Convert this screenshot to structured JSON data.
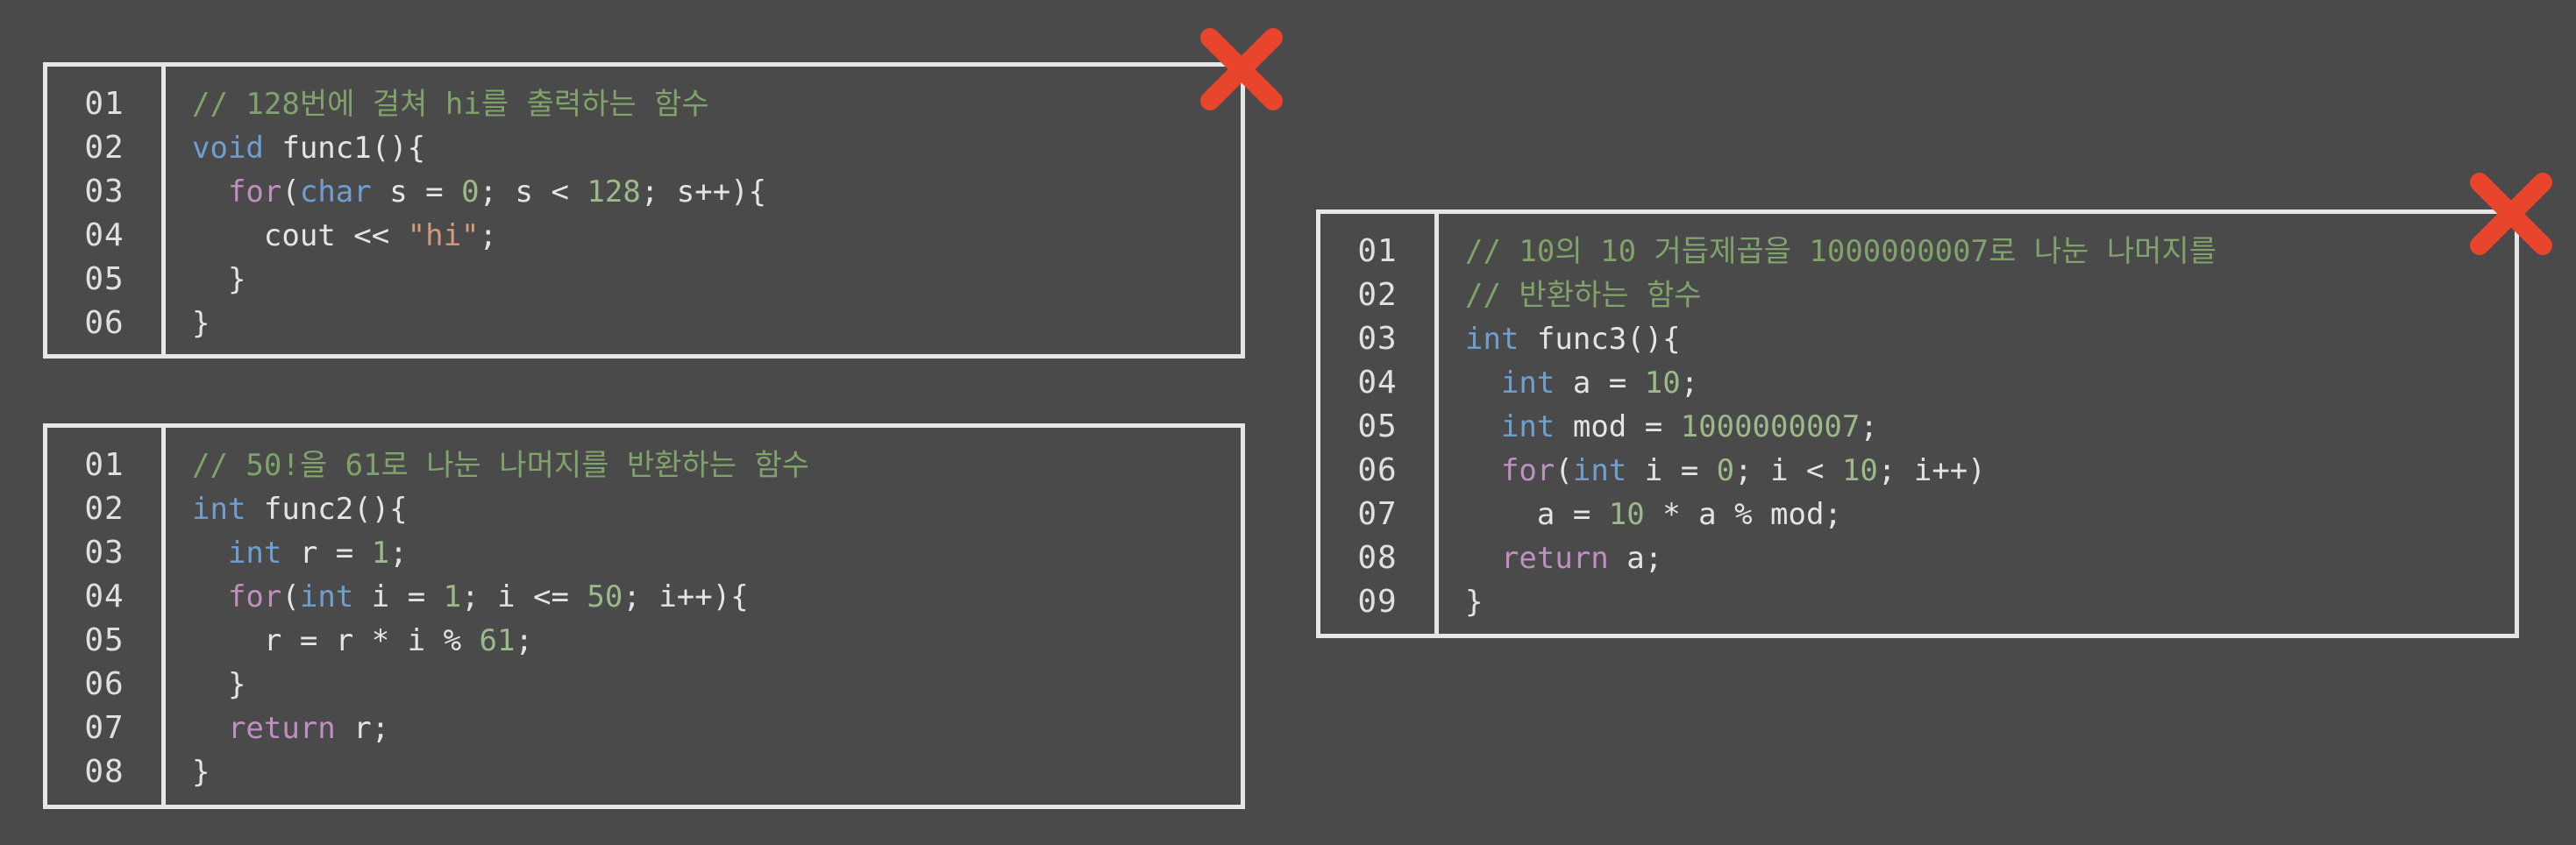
{
  "colors": {
    "background": "#4a4a4a",
    "border": "#e6e6e6",
    "comment": "#7fa36a",
    "keyword": "#6f9fd0",
    "control": "#bf8fc0",
    "number": "#9cb98a",
    "string": "#d19a7a",
    "plain": "#e4e4e4",
    "x_mark": "#e8452c"
  },
  "boxes": [
    {
      "id": "func1",
      "marked_wrong": true,
      "line_numbers": [
        "01",
        "02",
        "03",
        "04",
        "05",
        "06"
      ],
      "lines": [
        [
          [
            "comment",
            "// 128번에 걸쳐 hi를 출력하는 함수"
          ]
        ],
        [
          [
            "kw",
            "void"
          ],
          [
            "plain",
            " func1(){"
          ]
        ],
        [
          [
            "plain",
            "  "
          ],
          [
            "ctrl",
            "for"
          ],
          [
            "plain",
            "("
          ],
          [
            "kw",
            "char"
          ],
          [
            "plain",
            " s = "
          ],
          [
            "num",
            "0"
          ],
          [
            "plain",
            "; s < "
          ],
          [
            "num",
            "128"
          ],
          [
            "plain",
            "; s++){"
          ]
        ],
        [
          [
            "plain",
            "    cout << "
          ],
          [
            "str",
            "\"hi\""
          ],
          [
            "plain",
            ";"
          ]
        ],
        [
          [
            "plain",
            "  }"
          ]
        ],
        [
          [
            "plain",
            "}"
          ]
        ]
      ]
    },
    {
      "id": "func2",
      "marked_wrong": false,
      "line_numbers": [
        "01",
        "02",
        "03",
        "04",
        "05",
        "06",
        "07",
        "08"
      ],
      "lines": [
        [
          [
            "comment",
            "// 50!을 61로 나눈 나머지를 반환하는 함수"
          ]
        ],
        [
          [
            "kw",
            "int"
          ],
          [
            "plain",
            " func2(){"
          ]
        ],
        [
          [
            "plain",
            "  "
          ],
          [
            "kw",
            "int"
          ],
          [
            "plain",
            " r = "
          ],
          [
            "num",
            "1"
          ],
          [
            "plain",
            ";"
          ]
        ],
        [
          [
            "plain",
            "  "
          ],
          [
            "ctrl",
            "for"
          ],
          [
            "plain",
            "("
          ],
          [
            "kw",
            "int"
          ],
          [
            "plain",
            " i = "
          ],
          [
            "num",
            "1"
          ],
          [
            "plain",
            "; i <= "
          ],
          [
            "num",
            "50"
          ],
          [
            "plain",
            "; i++){"
          ]
        ],
        [
          [
            "plain",
            "    r = r * i % "
          ],
          [
            "num",
            "61"
          ],
          [
            "plain",
            ";"
          ]
        ],
        [
          [
            "plain",
            "  }"
          ]
        ],
        [
          [
            "plain",
            "  "
          ],
          [
            "ctrl",
            "return"
          ],
          [
            "plain",
            " r;"
          ]
        ],
        [
          [
            "plain",
            "}"
          ]
        ]
      ]
    },
    {
      "id": "func3",
      "marked_wrong": true,
      "line_numbers": [
        "01",
        "02",
        "03",
        "04",
        "05",
        "06",
        "07",
        "08",
        "09"
      ],
      "lines": [
        [
          [
            "comment",
            "// 10의 10 거듭제곱을 1000000007로 나눈 나머지를"
          ]
        ],
        [
          [
            "comment",
            "// 반환하는 함수"
          ]
        ],
        [
          [
            "kw",
            "int"
          ],
          [
            "plain",
            " func3(){"
          ]
        ],
        [
          [
            "plain",
            "  "
          ],
          [
            "kw",
            "int"
          ],
          [
            "plain",
            " a = "
          ],
          [
            "num",
            "10"
          ],
          [
            "plain",
            ";"
          ]
        ],
        [
          [
            "plain",
            "  "
          ],
          [
            "kw",
            "int"
          ],
          [
            "plain",
            " mod = "
          ],
          [
            "num",
            "1000000007"
          ],
          [
            "plain",
            ";"
          ]
        ],
        [
          [
            "plain",
            "  "
          ],
          [
            "ctrl",
            "for"
          ],
          [
            "plain",
            "("
          ],
          [
            "kw",
            "int"
          ],
          [
            "plain",
            " i = "
          ],
          [
            "num",
            "0"
          ],
          [
            "plain",
            "; i < "
          ],
          [
            "num",
            "10"
          ],
          [
            "plain",
            "; i++)"
          ]
        ],
        [
          [
            "plain",
            "    a = "
          ],
          [
            "num",
            "10"
          ],
          [
            "plain",
            " * a % mod;"
          ]
        ],
        [
          [
            "plain",
            "  "
          ],
          [
            "ctrl",
            "return"
          ],
          [
            "plain",
            " a;"
          ]
        ],
        [
          [
            "plain",
            "}"
          ]
        ]
      ]
    }
  ]
}
